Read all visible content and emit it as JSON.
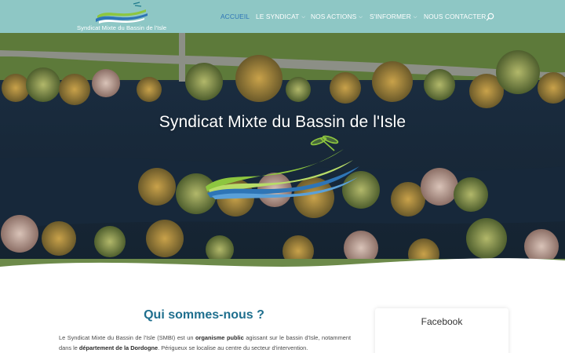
{
  "header": {
    "logo_text": "Syndicat Mixte du Bassin de l'Isle",
    "nav": [
      {
        "label": "ACCUEIL",
        "has_dropdown": false,
        "active": true
      },
      {
        "label": "LE SYNDICAT",
        "has_dropdown": true,
        "active": false
      },
      {
        "label": "NOS ACTIONS",
        "has_dropdown": true,
        "active": false
      },
      {
        "label": "S'INFORMER",
        "has_dropdown": true,
        "active": false
      },
      {
        "label": "NOUS CONTACTER",
        "has_dropdown": false,
        "active": false
      }
    ],
    "search_icon": "magnifier-icon"
  },
  "hero": {
    "title": "Syndicat Mixte du Bassin de l'Isle",
    "slides_total": 4,
    "active_slide": 1
  },
  "main": {
    "section_title": "Qui sommes-nous ?",
    "intro": {
      "p1_before": "Le Syndicat Mixte du Bassin de l'Isle (SMBI) est un ",
      "p1_bold1": "organisme public",
      "p1_mid": " agissant sur le bassin d'Isle, notamment dans le ",
      "p1_bold2": "département de la Dordogne",
      "p1_after": ". Périgueux se localise au centre du secteur d'intervention."
    }
  },
  "sidebar": {
    "widget_title": "Facebook"
  },
  "colors": {
    "header_bg": "#8ec7c5",
    "nav_active": "#2e75b6",
    "section_title": "#1f6f8e",
    "logo_green": "#8dc63f",
    "logo_blue": "#2e75b6"
  }
}
